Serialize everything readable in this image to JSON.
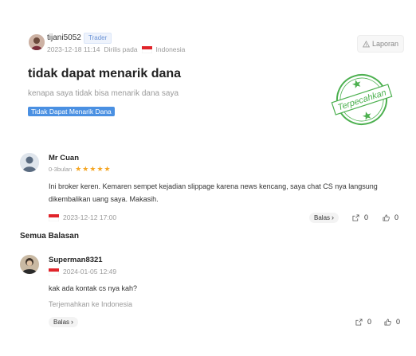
{
  "post": {
    "username": "tijani5052",
    "role_badge": "Trader",
    "datetime": "2023-12-18 11:14",
    "location_prefix": "Dirilis pada",
    "country": "Indonesia",
    "report_label": "Laporan",
    "title": "tidak dapat menarik dana",
    "body": "kenapa saya tidak bisa menarik dana saya",
    "category_tag": "Tidak Dapat Menarik Dana",
    "stamp_text": "Terpecahkan",
    "stamp_color": "#4cb04f"
  },
  "featured_comment": {
    "username": "Mr Cuan",
    "tenure": "0-3bulan",
    "stars": 5,
    "star_color": "#f5a623",
    "text": "Ini broker keren. Kemaren sempet kejadian slippage karena news kencang, saya chat CS nya langsung dikembalikan uang saya. Makasih.",
    "datetime": "2023-12-12 17:00",
    "reply_label": "Balas",
    "share_count": "0",
    "like_count": "0"
  },
  "all_replies_heading": "Semua Balasan",
  "replies": [
    {
      "username": "Superman8321",
      "datetime": "2024-01-05 12:49",
      "text": "kak ada kontak cs nya kah?",
      "translate_label": "Terjemahkan ke Indonesia",
      "reply_label": "Balas",
      "share_count": "0",
      "like_count": "0"
    }
  ],
  "icons": {
    "report": "warning-triangle-icon",
    "share": "share-icon",
    "like": "thumbs-up-icon",
    "reply_arrow": "chevron-right-icon"
  }
}
